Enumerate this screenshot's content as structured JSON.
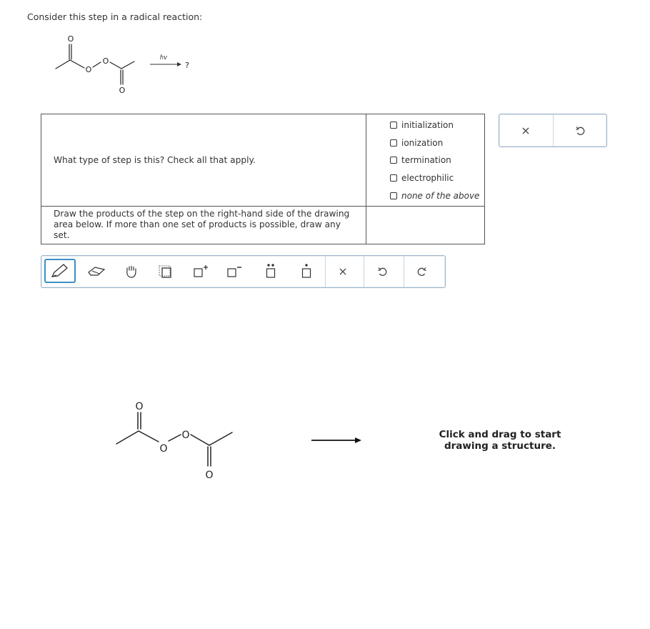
{
  "intro_text": "Consider this step in a radical reaction:",
  "reaction": {
    "condition": "hv",
    "product_placeholder": "?",
    "atom_label": "O"
  },
  "question1": {
    "prompt": "What type of step is this? Check all that apply.",
    "options": [
      {
        "label": "initialization",
        "checked": false
      },
      {
        "label": "ionization",
        "checked": false
      },
      {
        "label": "termination",
        "checked": false
      },
      {
        "label": "electrophilic",
        "checked": false
      },
      {
        "label": "none of the above",
        "checked": false
      }
    ]
  },
  "question2": {
    "prompt": "Draw the products of the step on the right-hand side of the drawing area below. If more than one set of products is possible, draw any set."
  },
  "answer_controls": {
    "clear_icon": "x-icon",
    "undo_icon": "undo-icon"
  },
  "toolbar": {
    "tools": [
      "pencil-icon",
      "eraser-icon",
      "hand-icon",
      "selection-box-icon",
      "positive-charge-icon",
      "negative-charge-icon",
      "lone-pair-icon",
      "radical-icon",
      "clear-icon",
      "undo-icon",
      "redo-icon"
    ]
  },
  "drawing_area": {
    "hint_line1": "Click and drag to start",
    "hint_line2": "drawing a structure."
  },
  "colors": {
    "active_tool": "#3d8fc6",
    "border": "#9cb3c8",
    "text": "#333333"
  }
}
